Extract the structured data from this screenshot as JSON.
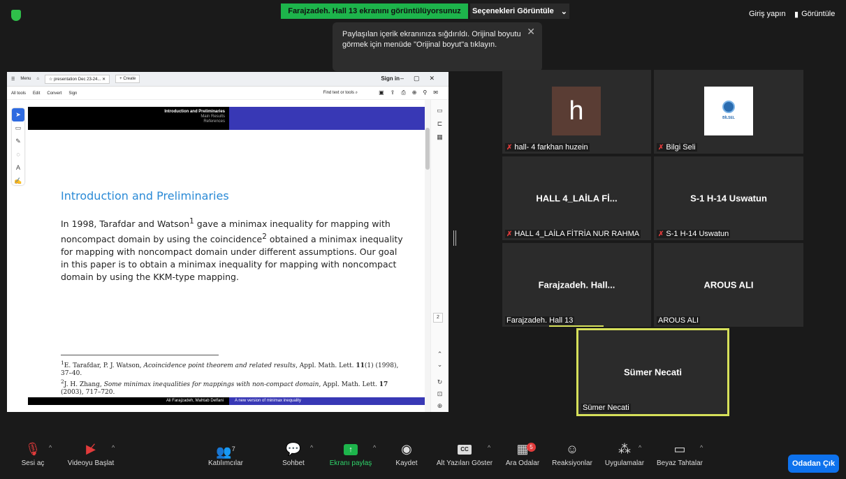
{
  "top_bar": {
    "share_banner": "Farajzadeh. Hall 13 ekranını görüntülüyorsunuz",
    "view_options": "Seçenekleri Görüntüle",
    "sign_in": "Giriş yapın",
    "view": "Görüntüle"
  },
  "tooltip": {
    "text": "Paylaşılan içerik ekranınıza sığdırıldı. Orijinal boyutu görmek için menüde \"Orijinal boyut\"a tıklayın."
  },
  "acrobat": {
    "menu": "Menu",
    "tab_title": "presentation Dec 23-24...",
    "create": "Create",
    "sign_in": "Sign in",
    "menu_items": [
      "All tools",
      "Edit",
      "Convert",
      "Sign"
    ],
    "find": "Find text or tools",
    "page_number": "2"
  },
  "slide": {
    "header_title": "Introduction and Preliminaries",
    "header_sub1": "Main Results",
    "header_sub2": "References",
    "title": "Introduction and Preliminaries",
    "body_p1": "In 1998, Tarafdar and Watson",
    "sup1": "1",
    "body_p2": " gave a minimax inequality for mapping with noncompact domain by using the coincidence",
    "sup2": "2",
    "body_p3": " obtained a minimax inequality for mapping with noncompact domain under different assumptions. Our goal in this paper is to obtain a minimax inequality for mapping with noncompact domain by using the KKM-type mapping.",
    "fn1_num": "1",
    "fn1_a": "E. Tarafdar, P. J. Watson, ",
    "fn1_italic": "Acoincidence point theorem and related results",
    "fn1_b": ", Appl. Math. Lett. ",
    "fn1_vol": "11",
    "fn1_c": "(1) (1998), 37–40.",
    "fn2_num": "2",
    "fn2_a": "J. H. Zhang, ",
    "fn2_italic": "Some minimax inequalities for mappings with non-compact domain",
    "fn2_b": ", Appl. Math. Lett. ",
    "fn2_vol": "17",
    "fn2_c": " (2003), 717–720.",
    "footer_left": "Ali Farajzadeh, Mahtab Delfani",
    "footer_right": "A new version of minimax inequality"
  },
  "participants": [
    {
      "name": "hall- 4 farkhan huzein",
      "avatar": "h",
      "muted": true
    },
    {
      "name": "Bilgi Seli",
      "avatar_logo": "BİLSEL",
      "muted": true
    },
    {
      "name": "HALL 4_LAİLA FİTRİA NUR RAHMA",
      "display": "HALL 4_LAİLA Fİ...",
      "muted": true
    },
    {
      "name": "S-1 H-14 Uswatun",
      "display": "S-1 H-14 Uswatun",
      "muted": true
    },
    {
      "name": "Farajzadeh. Hall 13",
      "display": "Farajzadeh.  Hall...",
      "muted": false
    },
    {
      "name": "AROUS ALI",
      "display": "AROUS ALI",
      "muted": false
    },
    {
      "name": "Sümer Necati",
      "display": "Sümer Necati",
      "muted": false
    }
  ],
  "toolbar": {
    "audio": "Sesi aç",
    "video": "Videoyu Başlat",
    "participants": "Katılımcılar",
    "participants_count": "7",
    "chat": "Sohbet",
    "share": "Ekranı paylaş",
    "record": "Kaydet",
    "captions": "Alt Yazıları Göster",
    "captions_icon": "CC",
    "breakout": "Ara Odalar",
    "breakout_badge": "5",
    "reactions": "Reaksiyonlar",
    "apps": "Uygulamalar",
    "whiteboard": "Beyaz Tahtalar",
    "leave": "Odadan Çık"
  },
  "colors": {
    "accent_green": "#1db44b",
    "active_speaker": "#d6e05a",
    "leave_blue": "#0e72ed",
    "muted_red": "#e23b3b",
    "slide_blue": "#3838b5"
  }
}
